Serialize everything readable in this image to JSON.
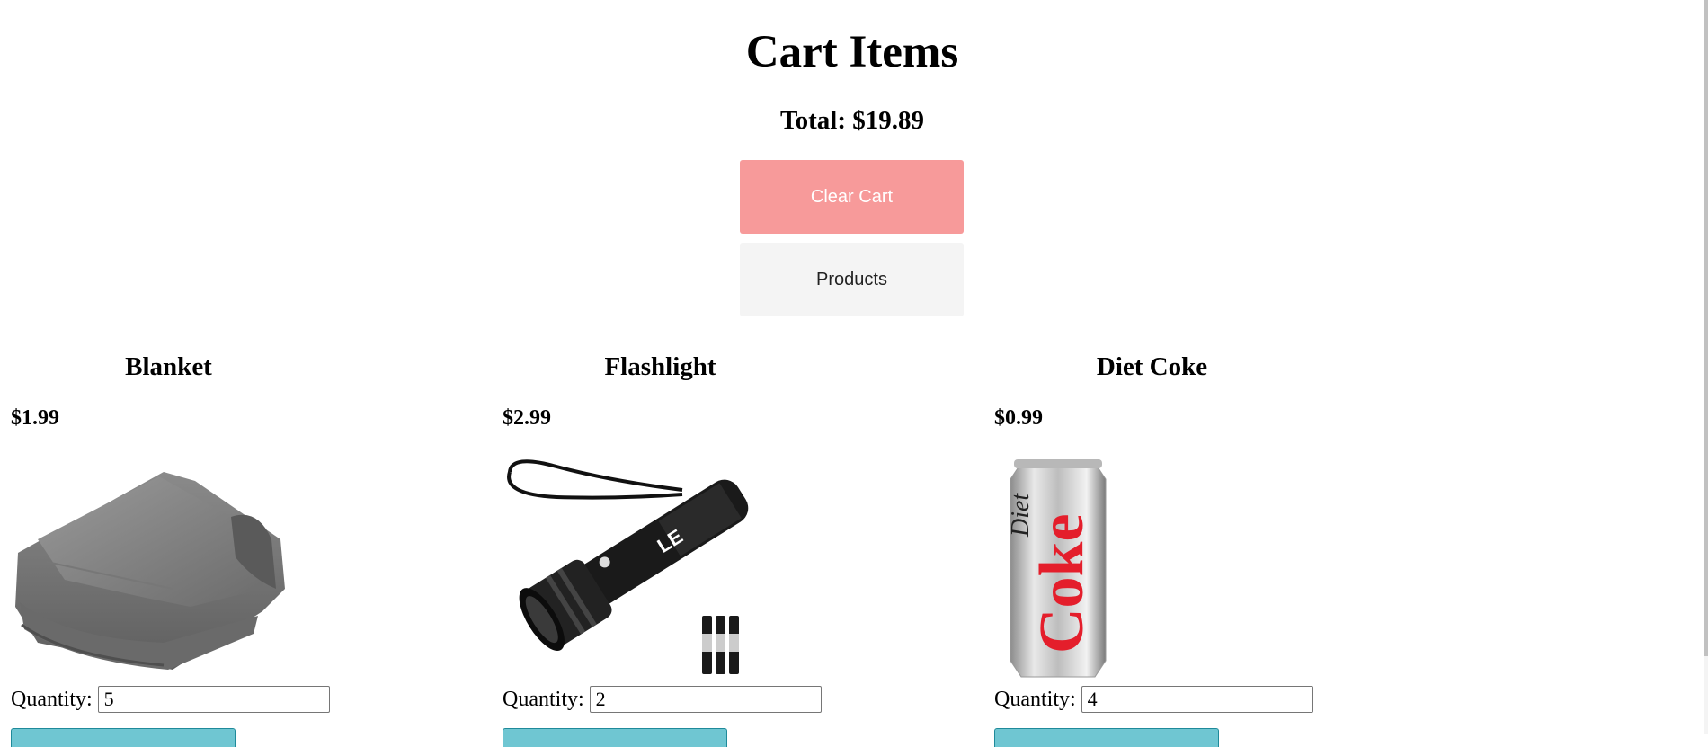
{
  "page": {
    "title": "Cart Items",
    "total": "Total: $19.89"
  },
  "buttons": {
    "clear_cart": "Clear Cart",
    "products": "Products"
  },
  "colors": {
    "clear_cart_bg": "#f79a9a",
    "products_bg": "#f4f4f4",
    "item_action_bg": "#6fc6d2"
  },
  "items": [
    {
      "name": "Blanket",
      "price": "$1.99",
      "quantity_label": "Quantity:",
      "quantity": "5",
      "image": "blanket-image"
    },
    {
      "name": "Flashlight",
      "price": "$2.99",
      "quantity_label": "Quantity:",
      "quantity": "2",
      "image": "flashlight-image"
    },
    {
      "name": "Diet Coke",
      "price": "$0.99",
      "quantity_label": "Quantity:",
      "quantity": "4",
      "image": "diet-coke-can-image"
    }
  ],
  "flashlight_image_text": "LE",
  "coke_image_text": {
    "brand": "Coke",
    "variant": "Diet"
  }
}
